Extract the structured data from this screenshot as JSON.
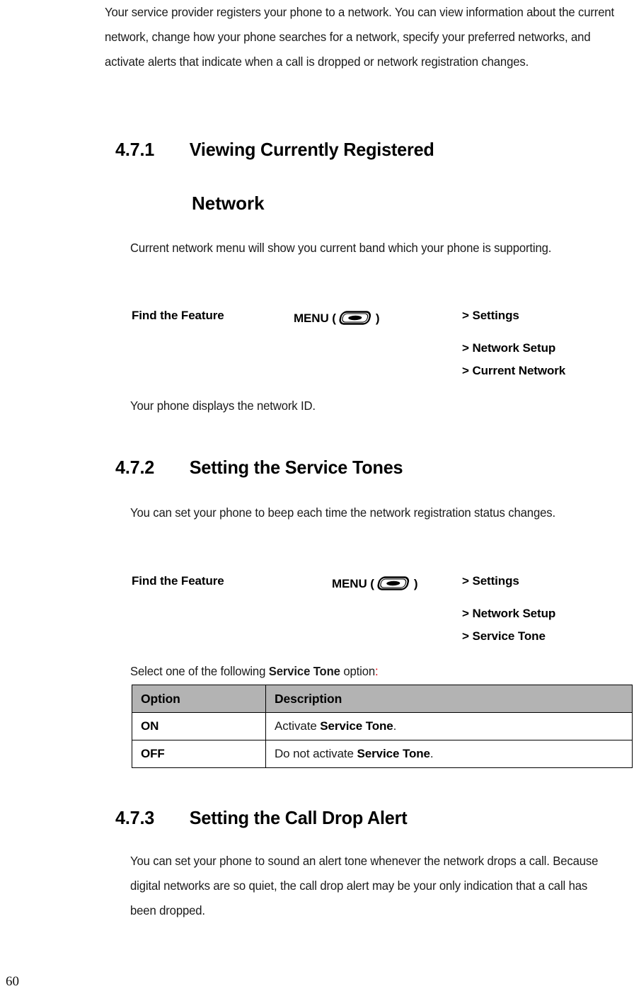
{
  "document": {
    "page_number": "60",
    "intro_paragraph": "Your service provider registers your phone to a network. You can view information about the current network, change how your phone searches for a network, specify your preferred networks, and activate alerts that indicate when a call is dropped or network registration changes.",
    "sections": [
      {
        "number": "4.7.1",
        "title_line1": "Viewing Currently Registered",
        "title_line2": "Network",
        "body": "Current network menu will show you current band which your phone is supporting.",
        "after_body": "Your phone displays the network ID."
      },
      {
        "number": "4.7.2",
        "title_line1": "Setting the Service Tones",
        "body": "You can set your phone to beep each time the network registration status changes."
      },
      {
        "number": "4.7.3",
        "title_line1": "Setting the Call Drop Alert",
        "body": "You can set your phone to sound an alert tone whenever the network drops a call. Because digital networks are so quiet, the call drop alert may be your only indication that a call has been dropped."
      }
    ],
    "find_the_feature_1": {
      "label": "Find the Feature",
      "menu_prefix": "MENU (",
      "menu_suffix": ")",
      "menu_icon": "menu-key-icon",
      "path": [
        "> Settings",
        "> Network Setup",
        "> Current Network"
      ]
    },
    "find_the_feature_2": {
      "label": "Find the Feature",
      "menu_prefix": "MENU (",
      "menu_suffix": ")",
      "menu_icon": "menu-key-icon",
      "path": [
        "> Settings",
        "> Network Setup",
        "> Service Tone"
      ]
    },
    "select_line": {
      "prefix": "Select one of the following ",
      "bold": "Service Tone",
      "suffix": " option",
      "colon": ":",
      "colon_color": "#e8000b"
    },
    "option_table": {
      "headers": [
        "Option",
        "Description"
      ],
      "header_bg": "#b3b3b3",
      "rows": [
        {
          "option": "ON",
          "desc_prefix": "Activate ",
          "desc_bold": "Service Tone",
          "desc_suffix": "."
        },
        {
          "option": "OFF",
          "desc_prefix": "Do not activate ",
          "desc_bold": "Service Tone",
          "desc_suffix": "."
        }
      ]
    }
  }
}
